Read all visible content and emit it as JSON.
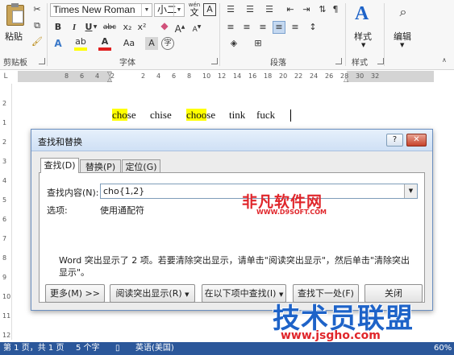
{
  "ribbon": {
    "clipboard": {
      "paste_label": "粘贴",
      "group_label": "剪贴板"
    },
    "font": {
      "font_name": "Times New Roman",
      "font_size": "小二",
      "wen_label": "wén",
      "wen_char": "文",
      "group_label": "字体",
      "bold": "B",
      "italic": "I",
      "underline": "U",
      "strike": "abc",
      "sub": "x₂",
      "sup": "x²",
      "font_color_glyph": "A",
      "grow": "A",
      "shrink": "A",
      "aa": "Aa",
      "border_a": "A"
    },
    "paragraph": {
      "group_label": "段落"
    },
    "styles": {
      "styles_label": "样式",
      "group_label": "样式"
    },
    "editing": {
      "edit_label": "编辑"
    }
  },
  "ruler": {
    "ticks": [
      "8",
      "6",
      "4",
      "2",
      "",
      "2",
      "4",
      "6",
      "8",
      "10",
      "12",
      "14",
      "16",
      "18",
      "20",
      "22",
      "24",
      "26",
      "28",
      "30",
      "32"
    ],
    "vticks": [
      "2",
      "1",
      "2",
      "3",
      "4",
      "5",
      "6",
      "7",
      "8",
      "9",
      "10",
      "11",
      "12"
    ]
  },
  "document": {
    "words": [
      {
        "pre": "",
        "hl": "cho",
        "post": "se"
      },
      {
        "pre": "chise",
        "hl": "",
        "post": ""
      },
      {
        "pre": "",
        "hl": "choo",
        "post": "se"
      },
      {
        "pre": "tink",
        "hl": "",
        "post": ""
      },
      {
        "pre": "fuck",
        "hl": "",
        "post": ""
      }
    ]
  },
  "dialog": {
    "title": "查找和替换",
    "help": "?",
    "close": "✕",
    "tabs": [
      "查找(D)",
      "替换(P)",
      "定位(G)"
    ],
    "find_label": "查找内容(N):",
    "find_value": "cho{1,2}",
    "options_label": "选项:",
    "options_value": "使用通配符",
    "message": "Word 突出显示了 2 项。若要清除突出显示，请单击\"阅读突出显示\"，然后单击\"清除突出显示\"。",
    "buttons": {
      "more": "更多(M) >>",
      "reading_highlight": "阅读突出显示(R)",
      "find_in": "在以下项中查找(I)",
      "find_next": "查找下一处(F)",
      "close": "关闭"
    }
  },
  "status": {
    "page": "第 1 页，共 1 页",
    "words": "5 个字",
    "lang": "英语(美国)",
    "zoom": "60%"
  },
  "watermarks": {
    "top_cn": "非凡软件网",
    "top_en": "WWW.D9SOFT.COM",
    "bottom_cn": "技术员联盟",
    "bottom_en": "www.jsgho.com"
  },
  "colors": {
    "accent": "#2b579a",
    "highlight": "#ffff00",
    "watermark_red": "#e0262b",
    "watermark_blue": "#1e63c8"
  }
}
